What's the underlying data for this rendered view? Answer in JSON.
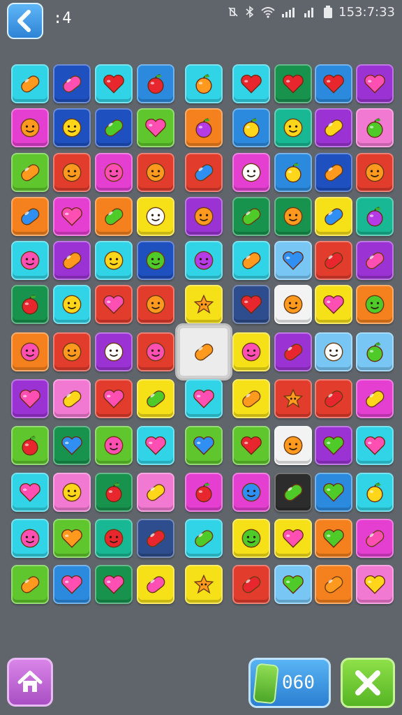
{
  "header": {
    "level_label": ":4",
    "status_time": "153:7:33"
  },
  "footer": {
    "moves_value": "060"
  },
  "colors": {
    "background": "#5f656b",
    "palette": {
      "A": "#31d3e6",
      "B": "#1e50c0",
      "R": "#e23c2c",
      "O": "#f5811e",
      "P": "#e43fd0",
      "V": "#9b33d4",
      "Y": "#f6e118",
      "G": "#5fc62d",
      "D": "#17934d",
      "L": "#78c6f4",
      "W": "#f3f3f3",
      "K": "#2c2c2c",
      "N": "#2e4d8e",
      "T": "#19b894",
      "M": "#2b8ade",
      "S": "#f279d2",
      "E": "#e43a4b"
    }
  },
  "grid": {
    "rows": 12,
    "cols": 9,
    "tiles": [
      [
        [
          "A",
          "bean-orange"
        ],
        [
          "B",
          "bean-pink"
        ],
        [
          "A",
          "heart-red"
        ],
        [
          "M",
          "apple-red"
        ],
        [
          "A",
          "apple-orange"
        ],
        [
          "A",
          "heart-red"
        ],
        [
          "D",
          "heart-red"
        ],
        [
          "M",
          "heart-red"
        ],
        [
          "V",
          "heart-pink"
        ]
      ],
      [
        [
          "P",
          "face-orange"
        ],
        [
          "B",
          "face-yellow"
        ],
        [
          "B",
          "bean-green"
        ],
        [
          "G",
          "heart-pink"
        ],
        [
          "O",
          "apple-purple"
        ],
        [
          "M",
          "lemon-yellow"
        ],
        [
          "T",
          "face-yellow"
        ],
        [
          "V",
          "bean-yellow"
        ],
        [
          "S",
          "apple-green"
        ]
      ],
      [
        [
          "G",
          "bean-orange"
        ],
        [
          "R",
          "face-orange"
        ],
        [
          "P",
          "face-pink"
        ],
        [
          "R",
          "face-orange"
        ],
        [
          "R",
          "bean-blue"
        ],
        [
          "P",
          "face-white"
        ],
        [
          "M",
          "lemon-yellow"
        ],
        [
          "B",
          "bean-orange"
        ],
        [
          "R",
          "face-orange"
        ]
      ],
      [
        [
          "O",
          "bean-blue"
        ],
        [
          "P",
          "heart-pink"
        ],
        [
          "O",
          "bean-green"
        ],
        [
          "Y",
          "face-white"
        ],
        [
          "V",
          "face-orange"
        ],
        [
          "D",
          "bean-green"
        ],
        [
          "D",
          "face-orange"
        ],
        [
          "Y",
          "bean-blue"
        ],
        [
          "T",
          "apple-purple"
        ]
      ],
      [
        [
          "A",
          "face-pink"
        ],
        [
          "V",
          "bean-orange"
        ],
        [
          "A",
          "face-yellow"
        ],
        [
          "B",
          "face-green"
        ],
        [
          "A",
          "blob-purple"
        ],
        [
          "A",
          "bean-orange"
        ],
        [
          "L",
          "heart-blue"
        ],
        [
          "R",
          "bean-red"
        ],
        [
          "V",
          "bean-pink"
        ]
      ],
      [
        [
          "D",
          "apple-red"
        ],
        [
          "A",
          "face-yellow"
        ],
        [
          "R",
          "heart-pink"
        ],
        [
          "R",
          "face-orange"
        ],
        [
          "Y",
          "star-orange"
        ],
        [
          "N",
          "heart-red"
        ],
        [
          "W",
          "face-orange"
        ],
        [
          "Y",
          "heart-pink"
        ],
        [
          "O",
          "face-green"
        ]
      ],
      [
        [
          "O",
          "face-pink"
        ],
        [
          "R",
          "face-orange"
        ],
        [
          "V",
          "face-white"
        ],
        [
          "R",
          "face-pink"
        ],
        [
          "W",
          "bean-orange"
        ],
        [
          "Y",
          "blob-pink"
        ],
        [
          "V",
          "bean-red"
        ],
        [
          "L",
          "face-white"
        ],
        [
          "L",
          "apple-green"
        ]
      ],
      [
        [
          "V",
          "heart-pink"
        ],
        [
          "S",
          "bean-yellow"
        ],
        [
          "R",
          "heart-pink"
        ],
        [
          "Y",
          "bean-green"
        ],
        [
          "A",
          "heart-pink"
        ],
        [
          "Y",
          "bean-orange"
        ],
        [
          "R",
          "star-orange"
        ],
        [
          "R",
          "bean-red"
        ],
        [
          "P",
          "bean-yellow"
        ]
      ],
      [
        [
          "G",
          "apple-red"
        ],
        [
          "D",
          "heart-blue"
        ],
        [
          "G",
          "face-pink"
        ],
        [
          "A",
          "heart-pink"
        ],
        [
          "G",
          "heart-blue"
        ],
        [
          "G",
          "heart-red"
        ],
        [
          "W",
          "face-orange"
        ],
        [
          "V",
          "heart-green"
        ],
        [
          "A",
          "heart-pink"
        ]
      ],
      [
        [
          "A",
          "heart-pink"
        ],
        [
          "S",
          "face-yellow"
        ],
        [
          "D",
          "apple-red"
        ],
        [
          "S",
          "bean-yellow"
        ],
        [
          "P",
          "apple-red"
        ],
        [
          "P",
          "blob-blue"
        ],
        [
          "K",
          "bean-green"
        ],
        [
          "M",
          "heart-green"
        ],
        [
          "A",
          "lemon-yellow"
        ]
      ],
      [
        [
          "A",
          "face-pink"
        ],
        [
          "G",
          "heart-orange"
        ],
        [
          "T",
          "face-red"
        ],
        [
          "N",
          "bean-red"
        ],
        [
          "A",
          "bean-green"
        ],
        [
          "Y",
          "face-green"
        ],
        [
          "Y",
          "heart-pink"
        ],
        [
          "O",
          "heart-green"
        ],
        [
          "P",
          "bean-pink"
        ]
      ],
      [
        [
          "G",
          "bean-orange"
        ],
        [
          "M",
          "heart-pink"
        ],
        [
          "D",
          "heart-pink"
        ],
        [
          "Y",
          "bean-pink"
        ],
        [
          "Y",
          "star-orange"
        ],
        [
          "R",
          "bean-red"
        ],
        [
          "L",
          "heart-green"
        ],
        [
          "O",
          "bean-orange"
        ],
        [
          "S",
          "heart-yellow"
        ]
      ]
    ],
    "selected": {
      "row": 6,
      "col": 4
    }
  }
}
